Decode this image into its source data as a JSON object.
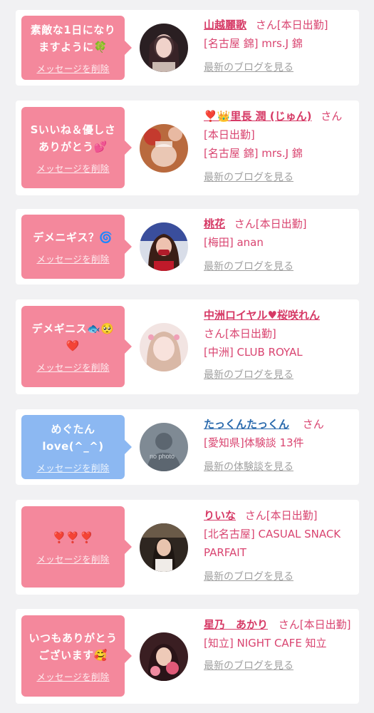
{
  "colors": {
    "pink": "#f4889c",
    "blue": "#8cb8f2",
    "name_pink": "#d63a66",
    "name_blue": "#2a6aad",
    "link_gray": "#a0a0a0"
  },
  "delete_label": "メッセージを削除",
  "cards": [
    {
      "message": "素敵な1日になり\nますように🍀",
      "name": "山越麗歌",
      "suffix": "さん[本日出勤]",
      "store": "[名古屋 錦] mrs.J 錦",
      "link": "最新のブログを見る"
    },
    {
      "message": "Sいいね＆優しさ\nありがとう💕",
      "name": "❣️👑里長 潤 (じゅん)",
      "suffix": "さん[本日出勤]",
      "store": "[名古屋 錦] mrs.J 錦",
      "link": "最新のブログを見る"
    },
    {
      "message": "デメニギス？🌀",
      "name": "桃花",
      "suffix": "さん[本日出勤]",
      "store": "[梅田] anan",
      "link": "最新のブログを見る"
    },
    {
      "message": "デメギニス🐟🥺\n❤️",
      "name": "中洲ロイヤル♥桜咲れん",
      "suffix": "さん[本日出勤]",
      "store": "[中洲] CLUB ROYAL",
      "link": "最新のブログを見る"
    },
    {
      "message": "めぐたん\nlove(^_^)",
      "name": "たっくんたっくん",
      "suffix": "さん",
      "store": "[愛知県]体験談 13件",
      "link": "最新の体験談を見る",
      "avatar_text": "no photo"
    },
    {
      "message": "❣️❣️❣️",
      "name": "りいな",
      "suffix": "さん[本日出勤]",
      "store": "[北名古屋] CASUAL SNACK PARFAIT",
      "link": "最新のブログを見る"
    },
    {
      "message": "いつもありがとう\nございます🥰",
      "name": "星乃　あかり",
      "suffix": "さん[本日出勤]",
      "store": "[知立] NIGHT CAFE 知立",
      "link": "最新のブログを見る"
    }
  ]
}
